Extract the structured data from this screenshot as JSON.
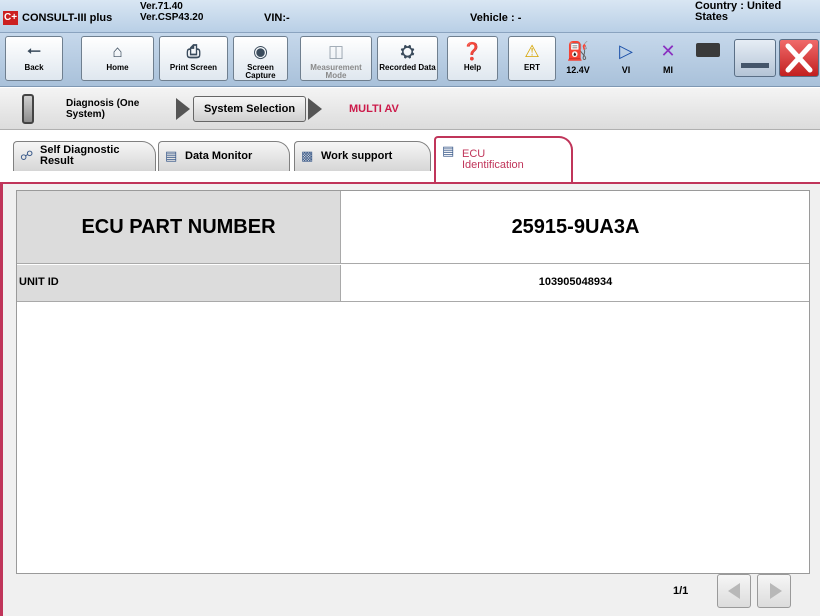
{
  "titlebar": {
    "app_name": "CONSULT-III plus",
    "version_line1": "Ver.71.40",
    "version_line2": "Ver.CSP43.20",
    "vin": "VIN:-",
    "vehicle": "Vehicle : -",
    "country": "Country : United States",
    "logo_text": "C+"
  },
  "toolbar": {
    "buttons": [
      {
        "label": "Back",
        "icon": "back-arrow-icon",
        "enabled": true
      },
      {
        "label": "Home",
        "icon": "home-icon",
        "enabled": true
      },
      {
        "label": "Print Screen",
        "icon": "printer-icon",
        "enabled": true
      },
      {
        "label": "Screen Capture",
        "icon": "camera-icon",
        "enabled": true
      },
      {
        "label": "Measurement Mode",
        "icon": "measurement-icon",
        "enabled": false
      },
      {
        "label": "Recorded Data",
        "icon": "recorded-data-icon",
        "enabled": true
      },
      {
        "label": "Help",
        "icon": "help-icon",
        "enabled": true
      },
      {
        "label": "ERT",
        "icon": "warning-icon",
        "enabled": true
      }
    ],
    "status": [
      {
        "label": "12.4V",
        "icon": "car-battery-icon"
      },
      {
        "label": "VI",
        "icon": "vi-signal-icon"
      },
      {
        "label": "MI",
        "icon": "mi-x-icon"
      }
    ]
  },
  "breadcrumb": {
    "step1": "Diagnosis (One System)",
    "step2": "System Selection",
    "step3": "MULTI AV"
  },
  "tabs": [
    {
      "label": "Self Diagnostic Result",
      "active": false
    },
    {
      "label": "Data Monitor",
      "active": false
    },
    {
      "label": "Work support",
      "active": false
    },
    {
      "label": "ECU Identification",
      "active": true
    }
  ],
  "ecu": {
    "part_number_label": "ECU PART NUMBER",
    "part_number_value": "25915-9UA3A",
    "unit_id_label": "UNIT ID",
    "unit_id_value": "103905048934"
  },
  "pager": {
    "text": "1/1"
  },
  "colors": {
    "accent": "#c0355a",
    "titlebar": "#c9dbee",
    "label_cell": "#dcdcdc",
    "close_red": "#d93a3a"
  }
}
